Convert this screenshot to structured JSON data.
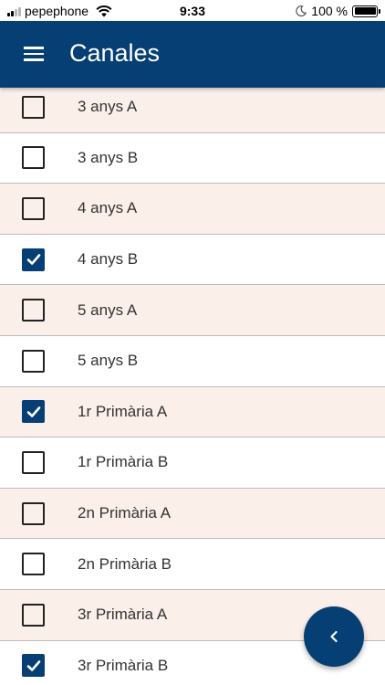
{
  "status_bar": {
    "carrier": "pepephone",
    "time": "9:33",
    "battery": "100 %",
    "battery_level": 1.0
  },
  "app_bar": {
    "title": "Canales",
    "menu_icon": "hamburger-menu-icon"
  },
  "channels": [
    {
      "label": "3 anys A",
      "checked": false
    },
    {
      "label": "3 anys B",
      "checked": false
    },
    {
      "label": "4 anys A",
      "checked": false
    },
    {
      "label": "4 anys B",
      "checked": true
    },
    {
      "label": "5 anys A",
      "checked": false
    },
    {
      "label": "5 anys B",
      "checked": false
    },
    {
      "label": "1r Primària A",
      "checked": true
    },
    {
      "label": "1r Primària B",
      "checked": false
    },
    {
      "label": "2n Primària A",
      "checked": false
    },
    {
      "label": "2n Primària B",
      "checked": false
    },
    {
      "label": "3r Primària A",
      "checked": false
    },
    {
      "label": "3r Primària B",
      "checked": true
    }
  ],
  "fab": {
    "icon": "chevron-left-icon"
  },
  "colors": {
    "primary": "#063f73",
    "row_alt": "#fbefe9",
    "divider": "#bcbcbc"
  }
}
